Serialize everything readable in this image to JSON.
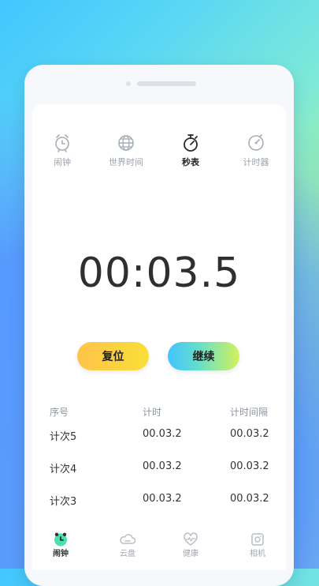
{
  "tabs": [
    {
      "label": "闹钟",
      "icon": "alarm-icon",
      "active": false
    },
    {
      "label": "世界时间",
      "icon": "globe-icon",
      "active": false
    },
    {
      "label": "秒表",
      "icon": "stopwatch-icon",
      "active": true
    },
    {
      "label": "计时器",
      "icon": "timer-icon",
      "active": false
    }
  ],
  "stopwatch": {
    "time": "00:03.5"
  },
  "buttons": {
    "reset": "复位",
    "continue": "继续"
  },
  "laps": {
    "headers": [
      "序号",
      "计时",
      "计时间隔"
    ],
    "rows": [
      {
        "label": "计次5",
        "time": "00.03.2",
        "interval": "00.03.2"
      },
      {
        "label": "计次4",
        "time": "00.03.2",
        "interval": "00.03.2"
      },
      {
        "label": "计次3",
        "time": "00.03.2",
        "interval": "00.03.2"
      }
    ]
  },
  "bottom_nav": [
    {
      "label": "闹钟",
      "icon": "alarm-clock-icon",
      "active": true
    },
    {
      "label": "云盘",
      "icon": "cloud-drive-icon",
      "active": false
    },
    {
      "label": "健康",
      "icon": "health-icon",
      "active": false
    },
    {
      "label": "相机",
      "icon": "camera-icon",
      "active": false
    }
  ],
  "colors": {
    "active_text": "#222222",
    "inactive_text": "#9ea4ad",
    "reset_button": "#ffc44a",
    "continue_button": "#43c3ff",
    "background_gradient_start": "#42c6ff",
    "background_gradient_end": "#d8f33d"
  }
}
